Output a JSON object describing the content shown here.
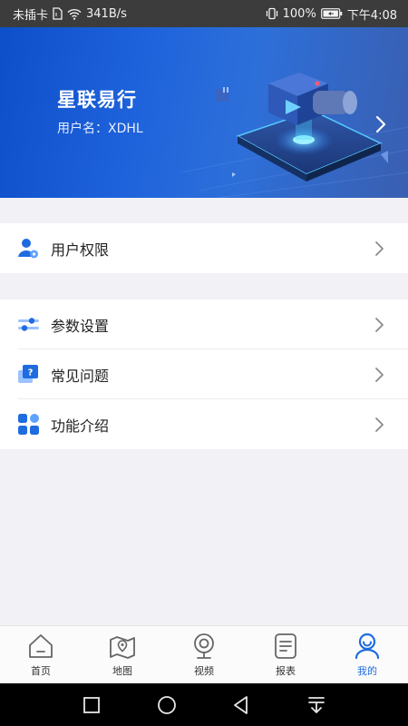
{
  "status_bar": {
    "carrier": "未插卡",
    "speed": "341B/s",
    "battery": "100%",
    "time": "下午4:08"
  },
  "header": {
    "title": "星联易行",
    "username": "用户名：XDHL"
  },
  "menu_group_1": [
    {
      "label": "用户权限",
      "icon": "user-permission-icon"
    }
  ],
  "menu_group_2": [
    {
      "label": "参数设置",
      "icon": "settings-sliders-icon"
    },
    {
      "label": "常见问题",
      "icon": "faq-icon"
    },
    {
      "label": "功能介绍",
      "icon": "features-grid-icon"
    }
  ],
  "tabs": [
    {
      "label": "首页",
      "icon": "home-icon",
      "active": false
    },
    {
      "label": "地图",
      "icon": "map-icon",
      "active": false
    },
    {
      "label": "视频",
      "icon": "video-camera-icon",
      "active": false
    },
    {
      "label": "报表",
      "icon": "report-icon",
      "active": false
    },
    {
      "label": "我的",
      "icon": "profile-icon",
      "active": true
    }
  ],
  "colors": {
    "accent": "#1f6be0",
    "hero_start": "#0d4fc9",
    "hero_end": "#3a5fb0",
    "background": "#f2f1f5"
  }
}
